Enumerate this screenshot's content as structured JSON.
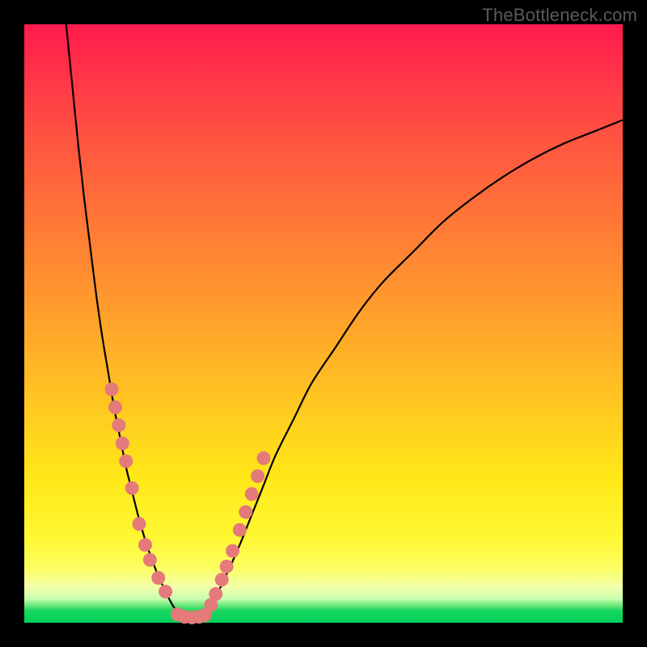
{
  "watermark": "TheBottleneck.com",
  "chart_data": {
    "type": "line",
    "title": "",
    "xlabel": "",
    "ylabel": "",
    "xlim": [
      0,
      100
    ],
    "ylim": [
      0,
      100
    ],
    "series": [
      {
        "name": "left-curve",
        "x": [
          7,
          8,
          9,
          10,
          11,
          12,
          13,
          14,
          15,
          16,
          17,
          18,
          19,
          20,
          21,
          22,
          23,
          24,
          25,
          26
        ],
        "values": [
          100,
          90,
          80,
          71,
          63,
          55,
          48,
          42,
          36,
          31,
          26,
          22,
          18,
          14.5,
          11.5,
          8.8,
          6.5,
          4.4,
          2.6,
          1.2
        ]
      },
      {
        "name": "right-curve",
        "x": [
          30,
          32,
          34,
          36,
          38,
          40,
          42,
          45,
          48,
          52,
          56,
          60,
          65,
          70,
          75,
          80,
          85,
          90,
          95,
          100
        ],
        "values": [
          1.2,
          4.4,
          8.5,
          13,
          18,
          23,
          28,
          34,
          40,
          46,
          52,
          57,
          62,
          67,
          71,
          74.5,
          77.5,
          80,
          82,
          84
        ]
      }
    ],
    "flat_segment": {
      "x": [
        26,
        30
      ],
      "y": 1.2
    },
    "marker_points": {
      "left": [
        [
          14.6,
          39
        ],
        [
          15.2,
          36
        ],
        [
          15.8,
          33
        ],
        [
          16.4,
          30
        ],
        [
          17.0,
          27
        ],
        [
          18.0,
          22.5
        ],
        [
          19.2,
          16.5
        ],
        [
          20.2,
          13
        ],
        [
          21.0,
          10.5
        ],
        [
          22.4,
          7.5
        ],
        [
          23.6,
          5.2
        ]
      ],
      "right": [
        [
          31.2,
          3.0
        ],
        [
          32.0,
          4.8
        ],
        [
          33.0,
          7.2
        ],
        [
          33.8,
          9.4
        ],
        [
          34.8,
          12.0
        ],
        [
          36.0,
          15.5
        ],
        [
          37.0,
          18.5
        ],
        [
          38.0,
          21.5
        ],
        [
          39.0,
          24.5
        ],
        [
          40.0,
          27.5
        ]
      ],
      "bottom": [
        [
          25.6,
          1.4
        ],
        [
          26.8,
          1.0
        ],
        [
          28.0,
          0.9
        ],
        [
          29.2,
          1.0
        ],
        [
          30.2,
          1.3
        ]
      ]
    },
    "marker_color": "#e47a7a",
    "curve_color": "#000000"
  }
}
